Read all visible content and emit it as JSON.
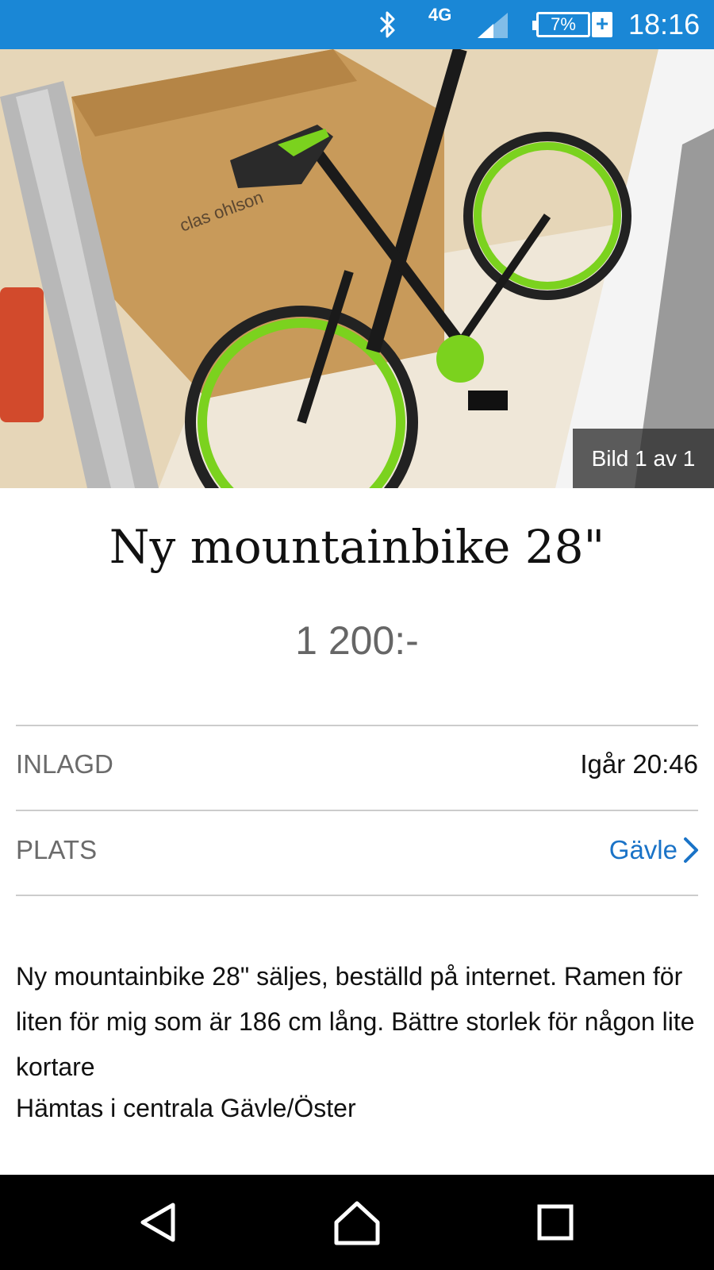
{
  "status_bar": {
    "network": "4G",
    "battery_percent": "7%",
    "charging_symbol": "+",
    "time": "18:16",
    "icons": [
      "bluetooth-icon",
      "signal-icon",
      "battery-icon",
      "charging-icon"
    ],
    "background_color": "#1a87d6"
  },
  "listing": {
    "photo_counter": "Bild 1 av 1",
    "title": "Ny mountainbike 28\"",
    "price": "1 200:-",
    "details": {
      "posted_label": "INLAGD",
      "posted_value": "Igår 20:46",
      "location_label": "PLATS",
      "location_value": "Gävle"
    },
    "description": "Ny mountainbike 28\" säljes, beställd på internet. Ramen för liten för mig som är 186 cm lång. Bättre storlek för någon lite kortare",
    "pickup": "Hämtas i centrala Gävle/Öster",
    "link_color": "#1a73c7"
  },
  "nav_bar": {
    "buttons": [
      "back-icon",
      "home-icon",
      "recents-icon"
    ]
  }
}
